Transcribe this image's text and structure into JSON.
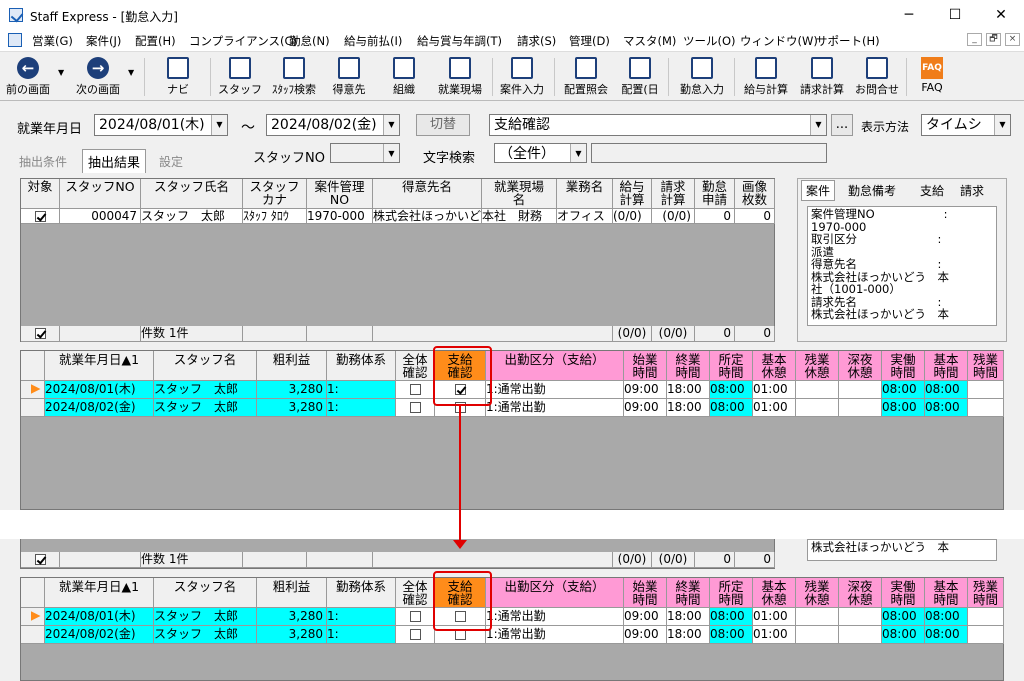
{
  "window": {
    "title": "Staff Express - [勤怠入力]",
    "buttons": [
      "─",
      "☐",
      "✕"
    ]
  },
  "menu": [
    "営業(G)",
    "案件(J)",
    "配置(H)",
    "コンプライアンス(C)",
    "勤怠(N)",
    "給与前払(I)",
    "給与賞与年調(T)",
    "請求(S)",
    "管理(D)",
    "マスタ(M)",
    "ツール(O)",
    "ウィンドウ(W)",
    "サポート(H)"
  ],
  "mdi_controls": [
    "_",
    "🗗",
    "×"
  ],
  "toolbar": [
    {
      "label": "前の画面",
      "icon": "back-icon"
    },
    {
      "label": "次の画面",
      "icon": "forward-icon"
    },
    {
      "label": "ナビ",
      "icon": "navi-icon"
    },
    {
      "label": "スタッフ",
      "icon": "staff-icon"
    },
    {
      "label": "ｽﾀｯﾌ検索",
      "icon": "staff-search-icon"
    },
    {
      "label": "得意先",
      "icon": "customer-icon"
    },
    {
      "label": "組織",
      "icon": "org-icon"
    },
    {
      "label": "就業現場",
      "icon": "worksite-icon"
    },
    {
      "label": "案件入力",
      "icon": "case-entry-icon"
    },
    {
      "label": "配置照会",
      "icon": "placement-query-icon"
    },
    {
      "label": "配置(日",
      "icon": "placement-day-icon"
    },
    {
      "label": "勤怠入力",
      "icon": "attendance-icon"
    },
    {
      "label": "給与計算",
      "icon": "payroll-icon"
    },
    {
      "label": "請求計算",
      "icon": "billing-icon"
    },
    {
      "label": "お問合せ",
      "icon": "inquiry-icon"
    },
    {
      "label": "FAQ",
      "icon": "faq-icon"
    }
  ],
  "filter": {
    "date_label": "就業年月日",
    "date_from": "2024/08/01(木)",
    "tilde": "～",
    "date_to": "2024/08/02(金)",
    "switch_button": "切替",
    "mode": "支給確認",
    "ellipsis": "...",
    "display_label": "表示方法",
    "display_value": "タイムシ",
    "staff_label": "スタッフNO",
    "staff_value": "",
    "search_label": "文字検索",
    "search_value": "（全件）",
    "search_text": ""
  },
  "tabs": [
    "抽出条件",
    "抽出結果",
    "設定"
  ],
  "upper_grid": {
    "headers": [
      "対象",
      "スタッフNO",
      "スタッフ氏名",
      "スタッフ\nカナ",
      "案件管理\nNO",
      "得意先名",
      "就業現場\n名",
      "業務名",
      "給与\n計算",
      "請求\n計算",
      "勤怠\n申請",
      "画像\n枚数"
    ],
    "row": [
      "",
      "000047",
      "スタッフ　太郎",
      "ｽﾀｯﾌ ﾀﾛｳ",
      "1970-000",
      "株式会社ほっかいどう",
      "本社　財務",
      "オフィス",
      "(0/0)",
      "(0/0)",
      "0",
      "0"
    ],
    "footer": {
      "count": "件数 1件",
      "salary": "(0/0)",
      "billing": "(0/0)",
      "req": "0",
      "img": "0"
    }
  },
  "side_tabs": [
    "案件",
    "勤怠備考",
    "支給",
    "請求"
  ],
  "info_lines": [
    "案件管理NO　　　　　　:",
    "1970-000",
    "取引区分　　　　　　　:",
    "派遣",
    "得意先名　　　　　　　:",
    "株式会社ほっかいどう　本",
    "社（1001-000）",
    "請求先名　　　　　　　:",
    "株式会社ほっかいどう　本"
  ],
  "lower_grid": {
    "headers": [
      "就業年月日▲1",
      "スタッフ名",
      "粗利益",
      "勤務体系",
      "全体\n確認",
      "支給\n確認",
      "出勤区分（支給）",
      "始業\n時間",
      "終業\n時間",
      "所定\n時間",
      "基本\n休憩",
      "残業\n休憩",
      "深夜\n休憩",
      "実働\n時間",
      "基本\n時間",
      "残業\n時間"
    ],
    "rows": [
      [
        "2024/08/01(木)",
        "スタッフ　太郎",
        "3,280",
        "1:",
        "",
        "",
        "1:通常出勤",
        "09:00",
        "18:00",
        "08:00",
        "01:00",
        "",
        "",
        "08:00",
        "08:00",
        ""
      ],
      [
        "2024/08/02(金)",
        "スタッフ　太郎",
        "3,280",
        "1:",
        "",
        "",
        "1:通常出勤",
        "09:00",
        "18:00",
        "08:00",
        "01:00",
        "",
        "",
        "08:00",
        "08:00",
        ""
      ]
    ],
    "checked_before": [
      true,
      false
    ],
    "checked_after": [
      false,
      false
    ]
  },
  "bottom_info": "株式会社ほっかいどう　本",
  "colors": {
    "cyan": "#00ffff",
    "pink": "#ff9ad5",
    "orange": "#ff8c1a",
    "highlight": "#e00000"
  }
}
